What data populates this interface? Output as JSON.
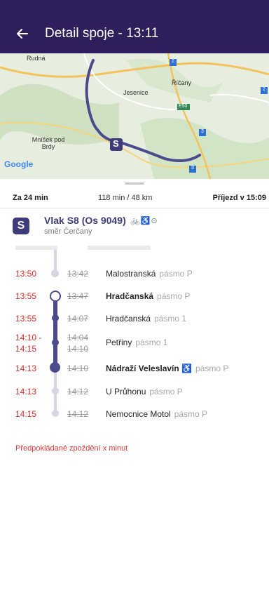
{
  "header": {
    "title": "Detail spoje - 13:11",
    "back_icon": "arrow-left-icon"
  },
  "map": {
    "labels": [
      "Rudná",
      "Říčany",
      "Jesenice",
      "Mníšek pod Brdy",
      "E50"
    ],
    "route_badge": "S",
    "road_badges": [
      "2",
      "3",
      "2",
      "3"
    ],
    "attribution": "Google"
  },
  "summary": {
    "left": "Za 24 min",
    "middle": "118 min / 48 km",
    "right": "Příjezd v 15:09"
  },
  "train": {
    "badge": "S",
    "name": "Vlak S8 (Os 9049)",
    "amenities": "🚲♿⊙",
    "direction": "směr Čerčany"
  },
  "stops": [
    {
      "actual": "13:50",
      "scheduled": "13:42",
      "name": "Malostranská",
      "zone": "pásmo P",
      "bold": false
    },
    {
      "actual": "13:55",
      "scheduled": "13:47",
      "name": "Hradčanská",
      "zone": "pásmo P",
      "bold": true
    },
    {
      "actual": "13:55",
      "scheduled": "14:07",
      "name": "Hradčanská",
      "zone": "pásmo 1",
      "bold": false
    },
    {
      "actual": "14:10 -\n14:15",
      "scheduled": "14:04\n14:10",
      "name": "Petřiny",
      "zone": "pásmo 1",
      "bold": false
    },
    {
      "actual": "14:13",
      "scheduled": "14:10",
      "name": "Nádraží Veleslavín",
      "zone": "pásmo P",
      "bold": true,
      "accessible": "♿"
    },
    {
      "actual": "14:13",
      "scheduled": "14:12",
      "name": "U Průhonu",
      "zone": "pásmo P",
      "bold": false
    },
    {
      "actual": "14:15",
      "scheduled": "14:12",
      "name": "Nemocnice Motol",
      "zone": "pásmo P",
      "bold": false
    }
  ],
  "delay_note": "Předpokládané zpoždění x minut",
  "colors": {
    "appbar": "#2e1f5c",
    "accent": "#3d3b7a",
    "delay": "#d82b2b",
    "route": "#4a4a8c"
  }
}
